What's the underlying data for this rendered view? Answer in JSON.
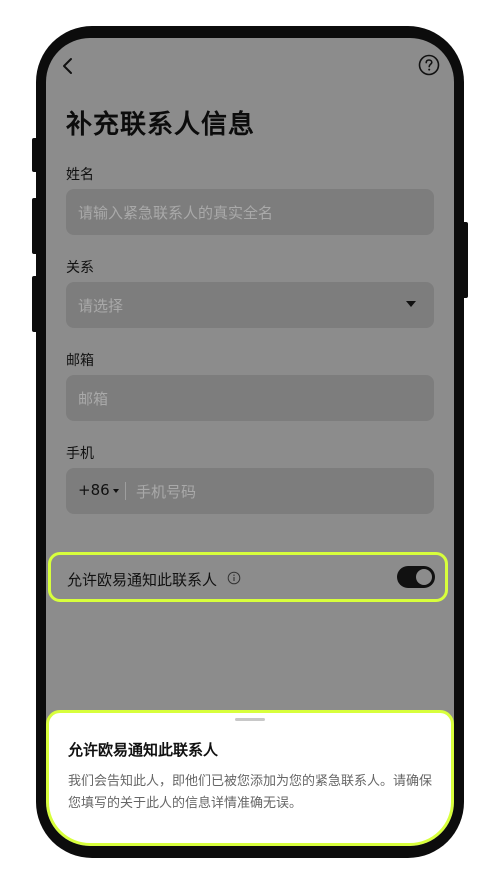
{
  "page": {
    "title": "补充联系人信息"
  },
  "fields": {
    "name": {
      "label": "姓名",
      "placeholder": "请输入紧急联系人的真实全名"
    },
    "relation": {
      "label": "关系",
      "placeholder": "请选择"
    },
    "email": {
      "label": "邮箱",
      "placeholder": "邮箱"
    },
    "phone": {
      "label": "手机",
      "country_code": "+86",
      "placeholder": "手机号码"
    }
  },
  "toggle": {
    "label": "允许欧易通知此联系人",
    "enabled": true
  },
  "sheet": {
    "title": "允许欧易通知此联系人",
    "body": "我们会告知此人，即他们已被您添加为您的紧急联系人。请确保您填写的关于此人的信息详情准确无误。"
  },
  "icons": {
    "back": "chevron-left-icon",
    "help": "question-circle-icon",
    "info": "info-circle-icon",
    "dropdown": "caret-down-icon"
  },
  "colors": {
    "highlight": "#d8ff3c",
    "overlay_bg": "#8c8c8c",
    "field_bg": "#7d7d7d",
    "text_dark": "#111111",
    "placeholder": "#a9a9a9"
  }
}
